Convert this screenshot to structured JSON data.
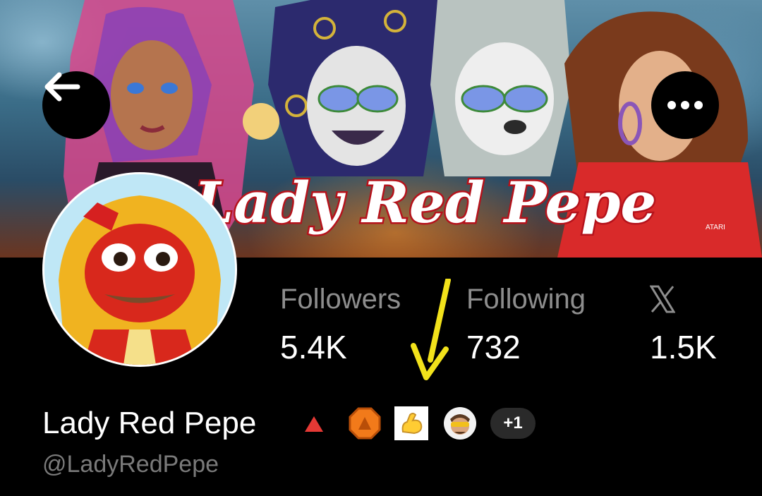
{
  "banner": {
    "title_art_text": "Lady Red Pepe",
    "shirt_text": "ATARI"
  },
  "nav": {
    "back_icon": "arrow-left-icon",
    "more_icon": "ellipsis-icon"
  },
  "stats": [
    {
      "label": "Followers",
      "value": "5.4K"
    },
    {
      "label": "Following",
      "value": "732"
    },
    {
      "label_icon": "x-logo-icon",
      "value": "1.5K"
    }
  ],
  "profile": {
    "display_name": "Lady Red Pepe",
    "handle": "@LadyRedPepe",
    "extra_badges": "+1"
  },
  "badges": [
    {
      "name": "red-triangle-icon",
      "color": "#e53935"
    },
    {
      "name": "orange-octagon-badge-icon",
      "color": "#f27a1a"
    },
    {
      "name": "flexed-biceps-emoji-icon",
      "color": "#ffcc33"
    },
    {
      "name": "user-avatar-badge-icon",
      "color": "#d9c7b0"
    }
  ],
  "annotation": {
    "arrow_color": "#f2e21b"
  }
}
